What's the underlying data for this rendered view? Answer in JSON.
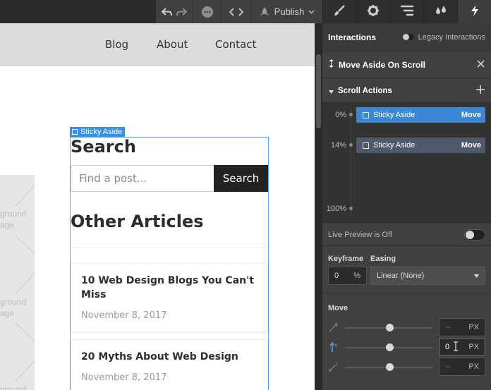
{
  "toolbar": {
    "publish_label": "Publish",
    "icons": [
      "undo-icon",
      "redo-icon",
      "comments-icon",
      "code-icon",
      "publish-icon",
      "chevron-down-icon"
    ]
  },
  "panel_tabs": [
    "style-brush-icon",
    "settings-gear-icon",
    "navigator-icon",
    "assets-drops-icon",
    "interactions-bolt-icon"
  ],
  "canvas": {
    "nav": [
      "Blog",
      "About",
      "Contact"
    ],
    "bg_image_label_1a": "ground",
    "bg_image_label_1b": "age",
    "bg_image_label_2a": "ground",
    "bg_image_label_2b": "age",
    "bg_image_label_3": "ground",
    "aside_tag": "Sticky Aside",
    "search_heading": "Search",
    "search_placeholder": "Find a post...",
    "search_button": "Search",
    "other_heading": "Other Articles",
    "cards": [
      {
        "title": "10 Web Design Blogs You Can't Miss",
        "date": "November 8, 2017"
      },
      {
        "title": "20 Myths About Web Design",
        "date": "November 8, 2017"
      }
    ]
  },
  "panel": {
    "interactions_title": "Interactions",
    "legacy_label": "Legacy Interactions",
    "interaction_name": "Move Aside On Scroll",
    "scroll_actions": "Scroll Actions",
    "timeline": [
      {
        "pct": "0%",
        "target": "Sticky Aside",
        "action": "Move",
        "active": true
      },
      {
        "pct": "14%",
        "target": "Sticky Aside",
        "action": "Move",
        "active": false
      }
    ],
    "timeline_end": "100%",
    "live_preview": "Live Preview is Off",
    "keyframe_label": "Keyframe",
    "keyframe_value": "0",
    "keyframe_unit": "%",
    "easing_label": "Easing",
    "easing_value": "Linear (None)",
    "move_label": "Move",
    "move": {
      "x": {
        "axis": "X",
        "value": "--",
        "unit": "PX"
      },
      "y": {
        "axis": "Y",
        "value": "0",
        "unit": "PX"
      },
      "z": {
        "axis": "Z",
        "value": "--",
        "unit": "PX"
      }
    }
  },
  "colors": {
    "accent_blue": "#3c87d4",
    "selection_blue": "#5aa3e6",
    "panel_bg": "#404040",
    "search_button_bg": "#222222"
  }
}
